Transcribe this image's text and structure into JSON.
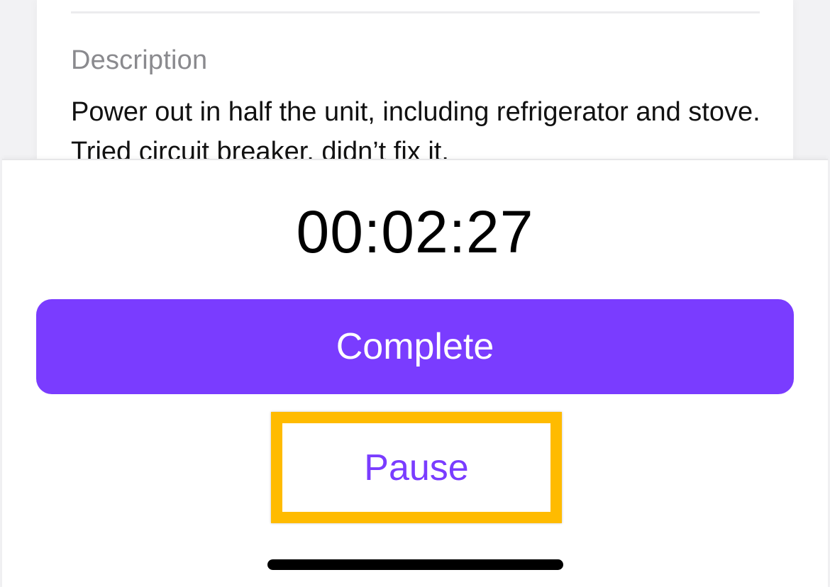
{
  "description": {
    "label": "Description",
    "text": "Power out in half the unit, including refrigerator and stove. Tried circuit breaker, didn’t fix it."
  },
  "timer": {
    "elapsed": "00:02:27"
  },
  "actions": {
    "complete_label": "Complete",
    "pause_label": "Pause"
  },
  "colors": {
    "accent": "#7a3cff",
    "highlight": "#ffbb00"
  }
}
